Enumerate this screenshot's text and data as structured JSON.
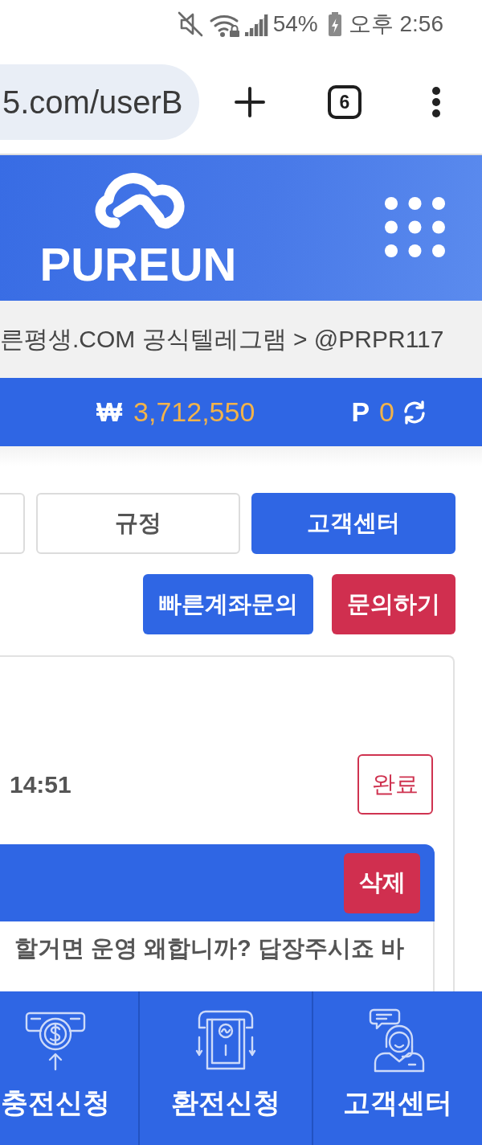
{
  "status_bar": {
    "battery": "54%",
    "time": "오후 2:56"
  },
  "browser": {
    "url": "5.com/userB",
    "tab_count": "6"
  },
  "header": {
    "logo": "PUREUN"
  },
  "notice": "른평생.COM 공식텔레그램 > @PRPR117",
  "balance": {
    "currency": "₩",
    "amount": "3,712,550",
    "points_label": "P",
    "points": "0"
  },
  "tabs": [
    {
      "selected": false
    },
    {
      "label": "규정",
      "selected": false
    },
    {
      "label": "고객센터",
      "selected": true
    }
  ],
  "actions": [
    {
      "label": "빠른계좌문의",
      "kind": "primary"
    },
    {
      "label": "문의하기",
      "kind": "danger"
    }
  ],
  "inquiry": {
    "time": "14:51",
    "status": "완료",
    "delete": "삭제",
    "message": "할거면 운영 왜합니까? 답장주시죠 바"
  },
  "bottom_nav": [
    {
      "label": "충전신청",
      "kind": "deposit"
    },
    {
      "label": "환전신청",
      "kind": "withdraw"
    },
    {
      "label": "고객센터",
      "kind": "support"
    }
  ]
}
